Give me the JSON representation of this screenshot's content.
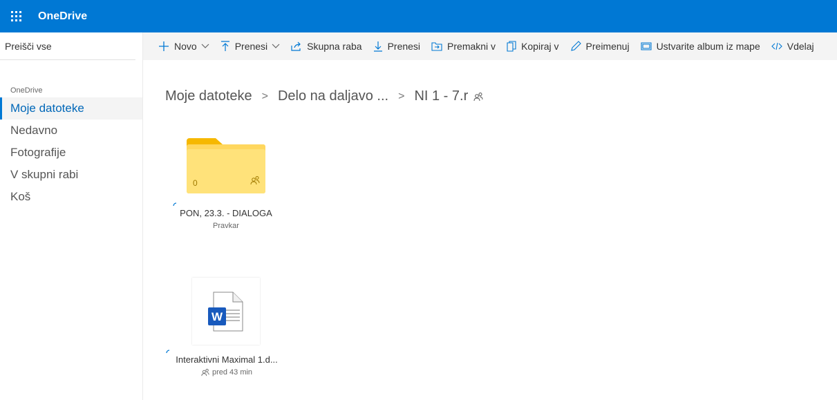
{
  "app": {
    "title": "OneDrive"
  },
  "search": {
    "placeholder": "Preišči vse"
  },
  "sidebar": {
    "heading": "OneDrive",
    "items": [
      {
        "label": "Moje datoteke",
        "active": true
      },
      {
        "label": "Nedavno"
      },
      {
        "label": "Fotografije"
      },
      {
        "label": "V skupni rabi"
      },
      {
        "label": "Koš"
      }
    ]
  },
  "commands": {
    "new": "Novo",
    "upload": "Prenesi",
    "share": "Skupna raba",
    "download": "Prenesi",
    "move": "Premakni v",
    "copy": "Kopiraj v",
    "rename": "Preimenuj",
    "album": "Ustvarite album iz mape",
    "embed": "Vdelaj"
  },
  "breadcrumb": [
    "Moje datoteke",
    "Delo na daljavo ...",
    "NI 1 - 7.r"
  ],
  "items": [
    {
      "type": "folder",
      "name": "PON, 23.3. - DIALOGA",
      "modified": "Pravkar",
      "count": "0"
    },
    {
      "type": "word",
      "name": "Interaktivni Maximal 1.d...",
      "modified": "pred 43 min",
      "word_letter": "W"
    }
  ],
  "colors": {
    "brand": "#0078d4",
    "folder": "#ffd75e",
    "folder_tab": "#f6b800",
    "word": "#185abd"
  }
}
